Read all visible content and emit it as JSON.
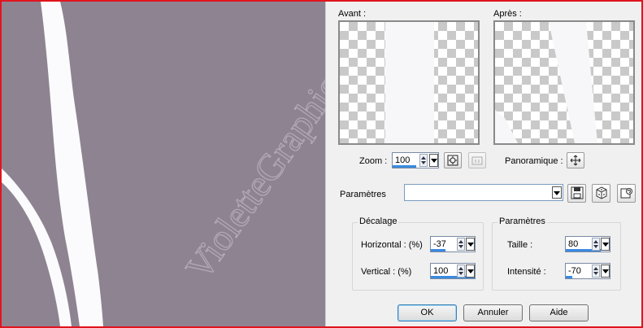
{
  "preview": {
    "before_label": "Avant :",
    "after_label": "Après :"
  },
  "zoom": {
    "label": "Zoom :",
    "value": "100",
    "fill": 0.5,
    "pan_label": "Panoramique :"
  },
  "presets": {
    "label": "Paramètres",
    "value": ""
  },
  "offset": {
    "title": "Décalage",
    "horizontal_label": "Horizontal : (%)",
    "horizontal_value": "-37",
    "horizontal_fill": 0.32,
    "vertical_label": "Vertical : (%)",
    "vertical_value": "100",
    "vertical_fill": 1.0
  },
  "params": {
    "title": "Paramètres",
    "size_label": "Taille :",
    "size_value": "80",
    "size_fill": 0.8,
    "intensity_label": "Intensité :",
    "intensity_value": "-70",
    "intensity_fill": 0.15
  },
  "buttons": {
    "ok": "OK",
    "cancel": "Annuler",
    "help": "Aide"
  },
  "canvas": {
    "watermark": "VioletteGraphic",
    "background_color": "#8e8491",
    "stripe_color": "#fbfbfd"
  },
  "accent_color": "#3a8ae0"
}
